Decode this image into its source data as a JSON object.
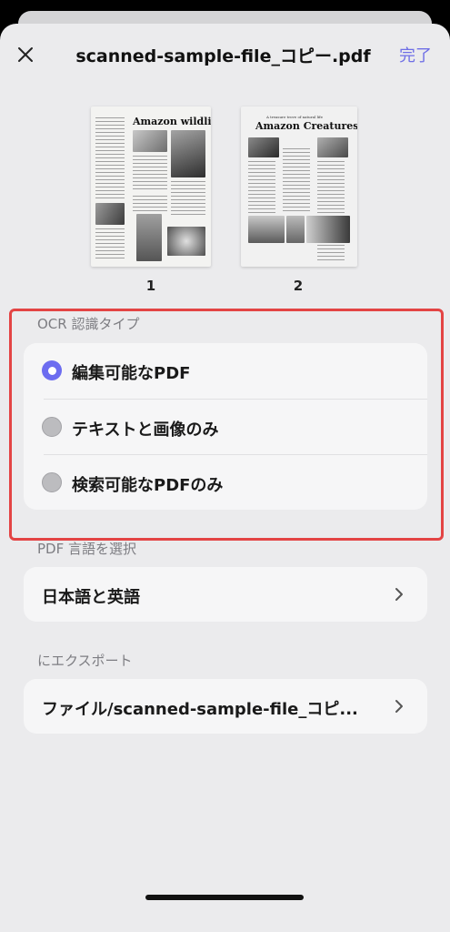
{
  "header": {
    "title": "scanned-sample-file_コピー.pdf",
    "done_label": "完了",
    "close_icon": "close-icon"
  },
  "thumbnails": [
    {
      "page_number": "1",
      "heading": "Amazon wildlife"
    },
    {
      "page_number": "2",
      "kicker": "A treasure trove of natural life",
      "heading": "Amazon Creatures"
    }
  ],
  "ocr": {
    "section_label": "OCR 認識タイプ",
    "options": [
      {
        "label": "編集可能なPDF",
        "selected": true
      },
      {
        "label": "テキストと画像のみ",
        "selected": false
      },
      {
        "label": "検索可能なPDFのみ",
        "selected": false
      }
    ]
  },
  "language": {
    "section_label": "PDF 言語を選択",
    "value": "日本語と英語",
    "icon": "chevron-right-icon"
  },
  "export": {
    "section_label": "にエクスポート",
    "value": "ファイル/scanned-sample-file_コピ...",
    "icon": "chevron-right-icon"
  },
  "colors": {
    "accent": "#6c6cf0",
    "highlight_border": "#e34444",
    "sheet_background": "#ebebed",
    "card_background": "#f6f6f7"
  }
}
